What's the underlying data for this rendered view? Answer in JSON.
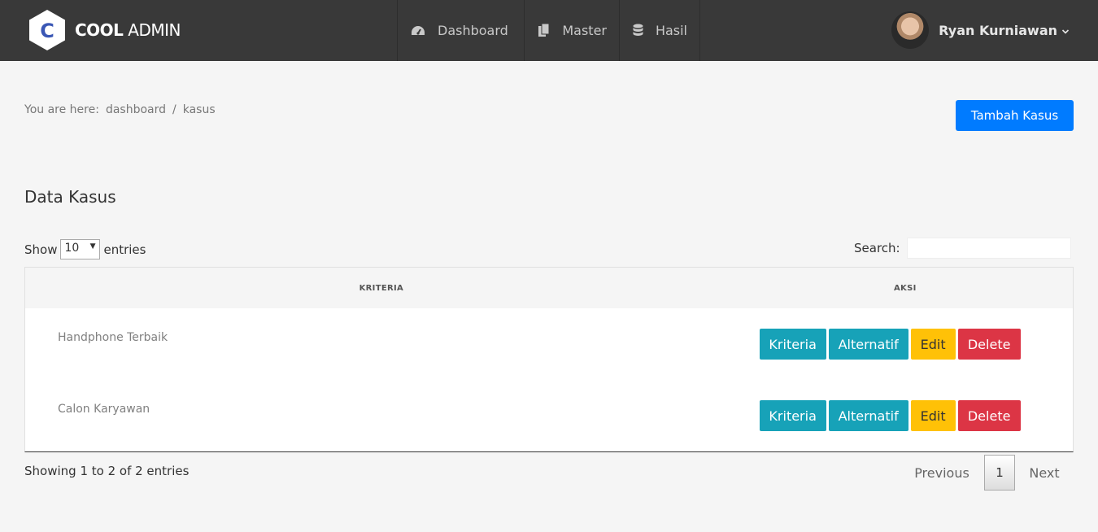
{
  "header": {
    "logo_letter": "C",
    "brand_bold": "COOL",
    "brand_light": "ADMIN",
    "nav": [
      {
        "label": "Dashboard",
        "icon": "dashboard-icon"
      },
      {
        "label": "Master",
        "icon": "copy-icon"
      },
      {
        "label": "Hasil",
        "icon": "database-icon"
      }
    ],
    "user_name": "Ryan Kurniawan"
  },
  "breadcrumb": {
    "prefix": "You are here:",
    "items": [
      "dashboard",
      "kasus"
    ],
    "separator": "/"
  },
  "add_button_label": "Tambah Kasus",
  "page_title": "Data Kasus",
  "table_controls": {
    "show_label": "Show",
    "entries_value": "10",
    "entries_label": "entries",
    "search_label": "Search:"
  },
  "table": {
    "headers": [
      "KRITERIA",
      "AKSI"
    ],
    "rows": [
      {
        "name": "Handphone Terbaik"
      },
      {
        "name": "Calon Karyawan"
      }
    ],
    "actions": {
      "kriteria": "Kriteria",
      "alternatif": "Alternatif",
      "edit": "Edit",
      "delete": "Delete"
    }
  },
  "footer": {
    "info": "Showing 1 to 2 of 2 entries",
    "previous": "Previous",
    "page": "1",
    "next": "Next"
  },
  "colors": {
    "header_bg": "#393939",
    "primary": "#007bff",
    "info": "#17a2b8",
    "warning": "#ffc107",
    "danger": "#dc3545"
  }
}
